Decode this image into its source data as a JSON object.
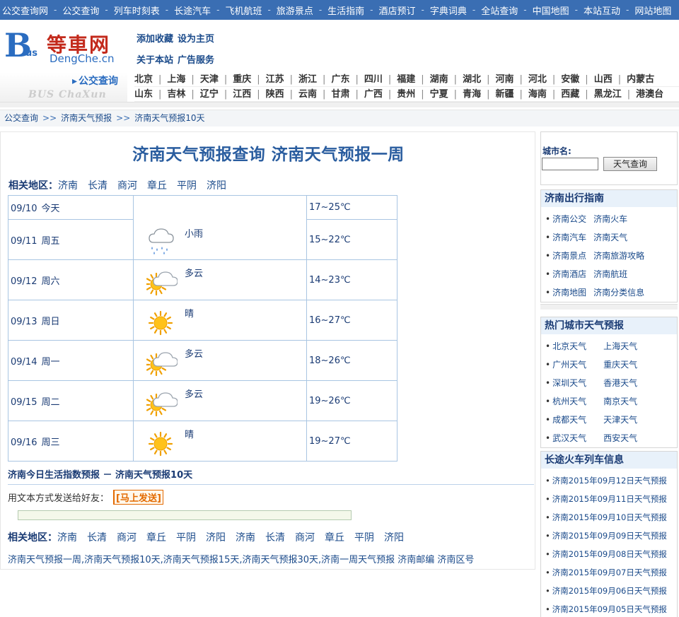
{
  "topnav": [
    "公交查询网",
    "公交查询",
    "列车时刻表",
    "长途汽车",
    "飞机航班",
    "旅游景点",
    "生活指南",
    "酒店预订",
    "字典词典",
    "全站查询",
    "中国地图",
    "本站互动",
    "网站地图"
  ],
  "logo": {
    "b": "B",
    "us": "us",
    "cn": "等車网",
    "domain": "DengChe.cn"
  },
  "header_links": {
    "fav": "添加收藏",
    "home": "设为主页",
    "about": "关于本站",
    "ads": "广告服务"
  },
  "citybar": {
    "title": "公交查询",
    "subtitle": "BUS ChaXun",
    "row1": [
      "北京",
      "上海",
      "天津",
      "重庆",
      "江苏",
      "浙江",
      "广东",
      "四川",
      "福建",
      "湖南",
      "湖北",
      "河南",
      "河北",
      "安徽",
      "山西",
      "内蒙古"
    ],
    "row2": [
      "山东",
      "吉林",
      "辽宁",
      "江西",
      "陕西",
      "云南",
      "甘肃",
      "广西",
      "贵州",
      "宁夏",
      "青海",
      "新疆",
      "海南",
      "西藏",
      "黑龙江",
      "港澳台"
    ]
  },
  "breadcrumb": [
    "公交查询",
    "济南天气预报",
    "济南天气预报10天"
  ],
  "main": {
    "title": "济南天气预报查询  济南天气预报一周",
    "related_label": "相关地区：",
    "related": [
      "济南",
      "长清",
      "商河",
      "章丘",
      "平阴",
      "济阳"
    ],
    "related2": [
      "济南",
      "长清",
      "商河",
      "章丘",
      "平阴",
      "济阳",
      "济南",
      "长清",
      "商河",
      "章丘",
      "平阴",
      "济阳"
    ],
    "forecast": [
      {
        "date": "09/10",
        "day": "今天",
        "cond": "",
        "temp": "17~25℃",
        "icon": "none"
      },
      {
        "date": "09/11",
        "day": "周五",
        "cond": "小雨",
        "temp": "15~22℃",
        "icon": "light-rain"
      },
      {
        "date": "09/12",
        "day": "周六",
        "cond": "多云",
        "temp": "14~23℃",
        "icon": "cloudy"
      },
      {
        "date": "09/13",
        "day": "周日",
        "cond": "晴",
        "temp": "16~27℃",
        "icon": "sunny"
      },
      {
        "date": "09/14",
        "day": "周一",
        "cond": "多云",
        "temp": "18~26℃",
        "icon": "cloudy"
      },
      {
        "date": "09/15",
        "day": "周二",
        "cond": "多云",
        "temp": "19~26℃",
        "icon": "cloudy"
      },
      {
        "date": "09/16",
        "day": "周三",
        "cond": "晴",
        "temp": "19~27℃",
        "icon": "sunny"
      }
    ],
    "life_link": "济南今日生活指数预报 － 济南天气预报10天",
    "send_text": "用文本方式发送给好友：",
    "send_btn": "[马上发送]",
    "bottom_links": "济南天气预报一周,济南天气预报10天,济南天气预报15天,济南天气预报30天,济南一周天气预报 济南邮编 济南区号"
  },
  "sidebar": {
    "search_label": "城市名:",
    "search_btn": "天气查询",
    "guide_title": "济南出行指南",
    "guide": [
      [
        "济南公交",
        "济南火车"
      ],
      [
        "济南汽车",
        "济南天气"
      ],
      [
        "济南景点",
        "济南旅游攻略"
      ],
      [
        "济南酒店",
        "济南航班"
      ],
      [
        "济南地图",
        "济南分类信息"
      ]
    ],
    "hot_title": "热门城市天气预报",
    "hot": [
      [
        "北京天气",
        "上海天气"
      ],
      [
        "广州天气",
        "重庆天气"
      ],
      [
        "深圳天气",
        "香港天气"
      ],
      [
        "杭州天气",
        "南京天气"
      ],
      [
        "成都天气",
        "天津天气"
      ],
      [
        "武汉天气",
        "西安天气"
      ]
    ],
    "train_title": "长途火车列车信息",
    "train": [
      "济南2015年09月12日天气预报",
      "济南2015年09月11日天气预报",
      "济南2015年09月10日天气预报",
      "济南2015年09月09日天气预报",
      "济南2015年09月08日天气预报",
      "济南2015年09月07日天气预报",
      "济南2015年09月06日天气预报",
      "济南2015年09月05日天气预报"
    ]
  }
}
